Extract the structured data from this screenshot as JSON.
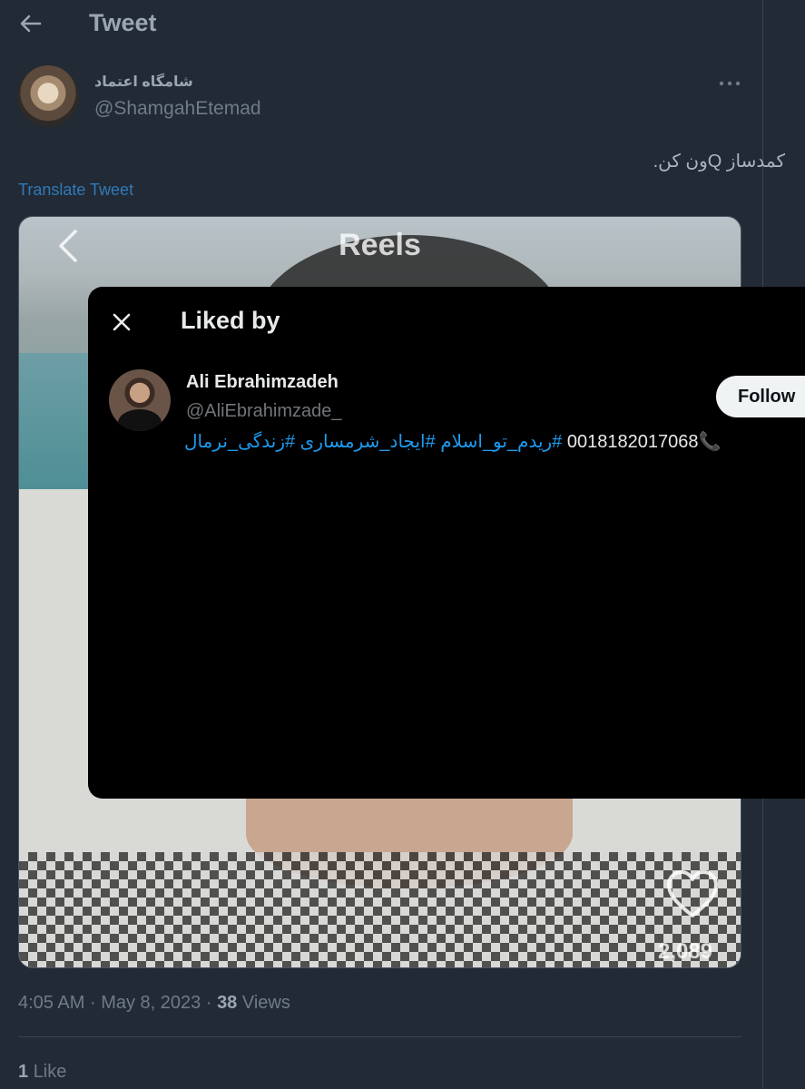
{
  "header": {
    "title": "Tweet",
    "back_icon": "arrow-left-icon"
  },
  "tweet": {
    "author_name": "شامگاه اعتماد",
    "author_handle": "@ShamgahEtemad",
    "text": "کمدساز Qون کن.",
    "translate_label": "Translate Tweet",
    "media": {
      "overlay_title": "Reels",
      "like_count": "2,089"
    },
    "meta": {
      "time": "4:05 AM",
      "date": "May 8, 2023",
      "sep": "·",
      "views_count": "38",
      "views_label": "Views"
    },
    "likes": {
      "count": "1",
      "label": "Like"
    }
  },
  "modal": {
    "title": "Liked by",
    "user": {
      "name": "Ali Ebrahimzadeh",
      "handle": "@AliEbrahimzade_",
      "follow_label": "Follow",
      "bio_phone": "📞0018182017068",
      "bio_tags": [
        "#ریدم_تو_اسلام",
        "#ایجاد_شرمساری",
        "#زندگی_نرمال"
      ]
    }
  },
  "colors": {
    "background": "#222a35",
    "modal": "#000000",
    "link": "#1d9bf0",
    "follow_bg": "#eff3f4"
  }
}
